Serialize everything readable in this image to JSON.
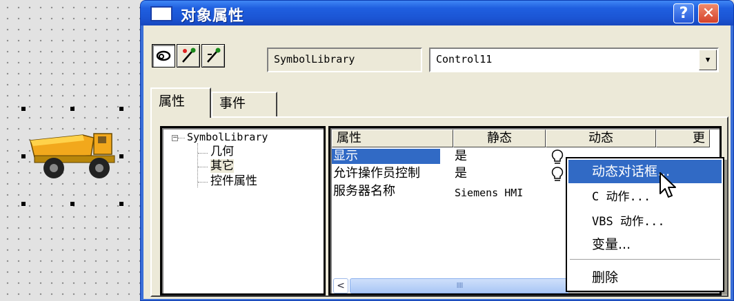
{
  "window": {
    "title": "对象属性",
    "help_label": "?",
    "close_label": "✕"
  },
  "toolbar": {
    "icons": [
      "link-icon",
      "pin-icon",
      "pin-edit-icon"
    ],
    "library_name": "SymbolLibrary",
    "object_name": "Control11"
  },
  "tabs": [
    {
      "label": "属性",
      "active": true
    },
    {
      "label": "事件",
      "active": false
    }
  ],
  "tree": {
    "root": "SymbolLibrary",
    "expander": "−",
    "items": [
      "几何",
      "其它",
      "控件属性"
    ],
    "selected": "其它"
  },
  "grid": {
    "columns": [
      "属性",
      "静态",
      "动态",
      "更"
    ],
    "rows": [
      {
        "name": "显示",
        "static": "是",
        "has_bulb": true,
        "selected": true
      },
      {
        "name": "允许操作员控制",
        "static": "是",
        "has_bulb": true,
        "selected": false
      },
      {
        "name": "服务器名称",
        "static": "Siemens HMI",
        "has_bulb": false,
        "selected": false
      }
    ],
    "scroll_left": "<",
    "scroll_grip": "IIII"
  },
  "context_menu": {
    "items": [
      {
        "label": "动态对话框...",
        "highlighted": true
      },
      {
        "label": "C 动作...",
        "highlighted": false
      },
      {
        "label": "VBS 动作...",
        "highlighted": false
      },
      {
        "label": "变量...",
        "highlighted": false
      },
      {
        "label": "删除",
        "highlighted": false
      }
    ]
  },
  "colors": {
    "titlebar": "#1f5fe0",
    "selection": "#316ac5",
    "dialog_face": "#ece9d8"
  }
}
